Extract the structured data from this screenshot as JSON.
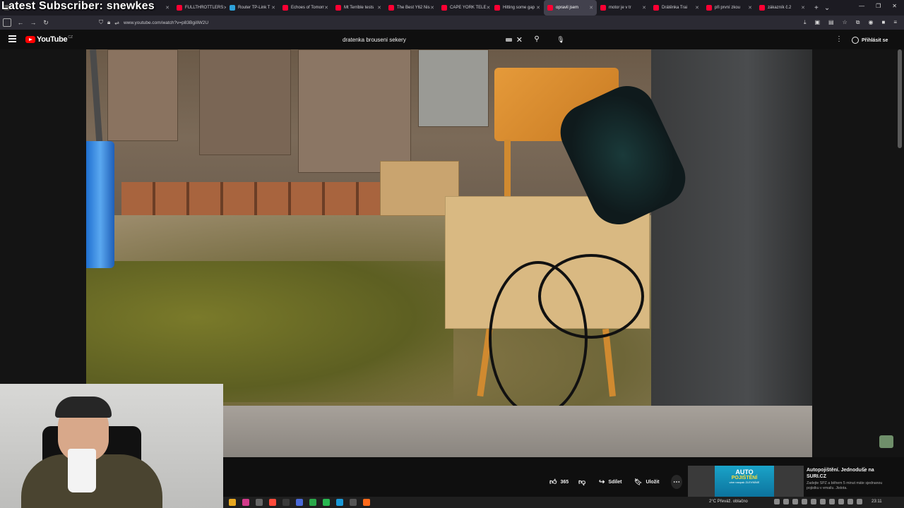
{
  "overlay": {
    "title": "Latest Subscriber: snewkes"
  },
  "tabs": [
    {
      "label": "",
      "color": "#666666"
    },
    {
      "label": "FULLTHROTTLERS",
      "color": "#ff0033"
    },
    {
      "label": "Router TP-Link T",
      "color": "#2da0d8"
    },
    {
      "label": "Echoes of Tomorr",
      "color": "#ff0033"
    },
    {
      "label": "Mt Terrible tests",
      "color": "#ff0033"
    },
    {
      "label": "The Best Y62 Nis",
      "color": "#ff0033"
    },
    {
      "label": "CAPE YORK TELE",
      "color": "#ff0033"
    },
    {
      "label": "Hitting some gap",
      "color": "#ff0033"
    },
    {
      "label": "opravil jsem",
      "color": "#ff0033",
      "active": true
    },
    {
      "label": "motor je v tr",
      "color": "#ff0033"
    },
    {
      "label": "Drátěnka Trai",
      "color": "#ff0033"
    },
    {
      "label": "při první zkou",
      "color": "#ff0033"
    },
    {
      "label": "zákazník č.2",
      "color": "#ff0033"
    }
  ],
  "browser": {
    "url": "www.youtube.com/watch?v=p83BgiIlW2U"
  },
  "youtube": {
    "logo_text": "YouTube",
    "country": "CZ",
    "search_value": "dratenka brouseni sekery",
    "sign_in": "Přihlásit se"
  },
  "actions": {
    "likes": "365",
    "share": "Sdílet",
    "save": "Uložit"
  },
  "ad": {
    "banner_line1": "AUTO",
    "banner_line2": "POJIŠTĚNÍ",
    "banner_line3": "vám naopak ZLEVNÍME",
    "title": "Autopojištění. Jednoduše na SURI.CZ",
    "desc": "Zadejte SPZ a během 5 minut máte sjednanou pojistku v emailu. Jistota."
  },
  "taskbar": {
    "weather": "2°C  Převáž. oblačno",
    "clock": "23:11"
  },
  "colors": {
    "accent": "#ff0000",
    "background": "#0f0f0f"
  }
}
